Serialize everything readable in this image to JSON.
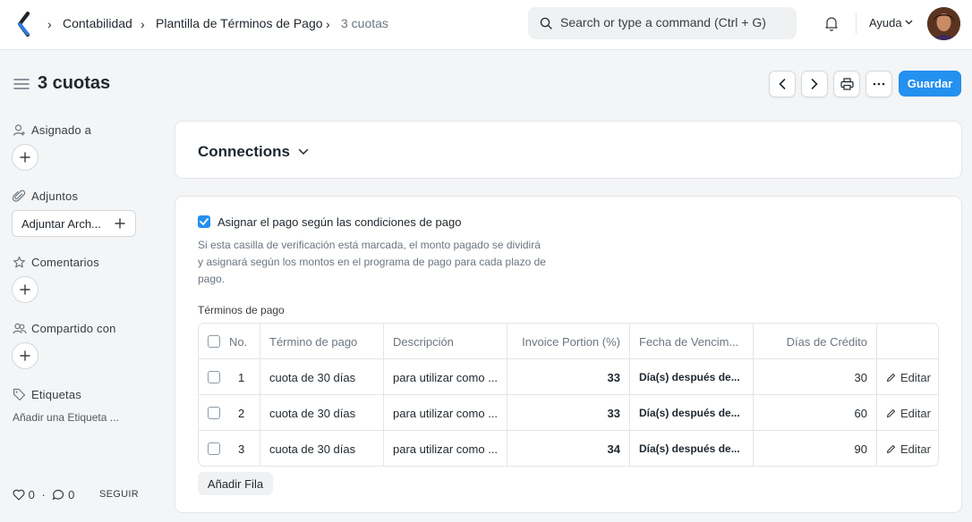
{
  "navbar": {
    "breadcrumbs": [
      "Contabilidad",
      "Plantilla de Términos de Pago",
      "3 cuotas"
    ],
    "search_placeholder": "Search or type a command (Ctrl + G)",
    "help_label": "Ayuda"
  },
  "page": {
    "title": "3 cuotas",
    "save_label": "Guardar"
  },
  "sidebar": {
    "assigned_label": "Asignado a",
    "attachments_label": "Adjuntos",
    "attach_button": "Adjuntar Arch...",
    "comments_label": "Comentarios",
    "shared_label": "Compartido con",
    "tags_label": "Etiquetas",
    "add_tag": "Añadir una Etiqueta ...",
    "likes": "0",
    "comments_count": "0",
    "follow_label": "SEGUIR"
  },
  "connections": {
    "title": "Connections"
  },
  "form": {
    "checkbox_label": "Asignar el pago según las condiciones de pago",
    "checkbox_checked": true,
    "checkbox_description": "Si esta casilla de verificación está marcada, el monto pagado se dividirá y asignará según los montos en el programa de pago para cada plazo de pago.",
    "terms_label": "Términos de pago",
    "add_row_label": "Añadir Fila"
  },
  "table": {
    "headers": [
      "No.",
      "Término de pago",
      "Descripción",
      "Invoice Portion (%)",
      "Fecha de Vencim...",
      "Días de Crédito"
    ],
    "edit_label": "Editar",
    "rows": [
      {
        "no": "1",
        "term": "cuota de 30 días",
        "description": "para utilizar como ...",
        "portion": "33",
        "due": "Día(s) después de...",
        "credit_days": "30"
      },
      {
        "no": "2",
        "term": "cuota de 30 días",
        "description": "para utilizar como ...",
        "portion": "33",
        "due": "Día(s) después de...",
        "credit_days": "60"
      },
      {
        "no": "3",
        "term": "cuota de 30 días",
        "description": "para utilizar como ...",
        "portion": "34",
        "due": "Día(s) después de...",
        "credit_days": "90"
      }
    ]
  },
  "colors": {
    "accent": "#2490ef",
    "text": "#1f272e",
    "muted": "#6c7680",
    "border": "#e2e6e9",
    "background": "#f4f5f6"
  }
}
